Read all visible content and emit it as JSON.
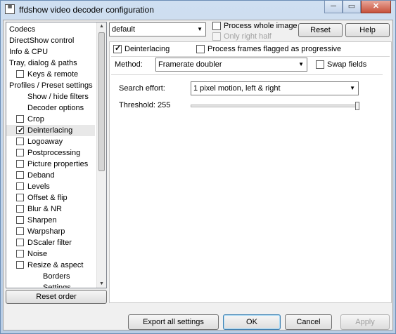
{
  "window": {
    "title": "ffdshow video decoder configuration",
    "minimize_glyph": "─",
    "maximize_glyph": "▭",
    "close_glyph": "✕"
  },
  "tree": {
    "items": [
      {
        "label": "Codecs",
        "checkbox": false,
        "checked": false,
        "indent": 0
      },
      {
        "label": "DirectShow control",
        "checkbox": false,
        "checked": false,
        "indent": 0
      },
      {
        "label": "Info & CPU",
        "checkbox": false,
        "checked": false,
        "indent": 0
      },
      {
        "label": "Tray, dialog & paths",
        "checkbox": false,
        "checked": false,
        "indent": 0
      },
      {
        "label": "Keys & remote",
        "checkbox": true,
        "checked": false,
        "indent": 1
      },
      {
        "label": "Profiles / Preset settings",
        "checkbox": false,
        "checked": false,
        "indent": 0
      },
      {
        "label": "Show / hide filters",
        "checkbox": false,
        "checked": false,
        "indent": 1
      },
      {
        "label": "Decoder options",
        "checkbox": false,
        "checked": false,
        "indent": 1
      },
      {
        "label": "Crop",
        "checkbox": true,
        "checked": false,
        "indent": 1
      },
      {
        "label": "Deinterlacing",
        "checkbox": true,
        "checked": true,
        "indent": 1,
        "selected": true
      },
      {
        "label": "Logoaway",
        "checkbox": true,
        "checked": false,
        "indent": 1
      },
      {
        "label": "Postprocessing",
        "checkbox": true,
        "checked": false,
        "indent": 1
      },
      {
        "label": "Picture properties",
        "checkbox": true,
        "checked": false,
        "indent": 1
      },
      {
        "label": "Deband",
        "checkbox": true,
        "checked": false,
        "indent": 1
      },
      {
        "label": "Levels",
        "checkbox": true,
        "checked": false,
        "indent": 1
      },
      {
        "label": "Offset & flip",
        "checkbox": true,
        "checked": false,
        "indent": 1
      },
      {
        "label": "Blur & NR",
        "checkbox": true,
        "checked": false,
        "indent": 1
      },
      {
        "label": "Sharpen",
        "checkbox": true,
        "checked": false,
        "indent": 1
      },
      {
        "label": "Warpsharp",
        "checkbox": true,
        "checked": false,
        "indent": 1
      },
      {
        "label": "DScaler filter",
        "checkbox": true,
        "checked": false,
        "indent": 1
      },
      {
        "label": "Noise",
        "checkbox": true,
        "checked": false,
        "indent": 1
      },
      {
        "label": "Resize & aspect",
        "checkbox": true,
        "checked": false,
        "indent": 1
      },
      {
        "label": "Borders",
        "checkbox": false,
        "checked": false,
        "indent": 2
      },
      {
        "label": "Settings",
        "checkbox": false,
        "checked": false,
        "indent": 2
      }
    ],
    "scroll_up_glyph": "▲",
    "scroll_down_glyph": "▼"
  },
  "reset_order_label": "Reset order",
  "top": {
    "preset_value": "default",
    "process_whole_image_label": "Process whole image",
    "process_whole_image_checked": false,
    "only_right_half_label": "Only right half",
    "only_right_half_checked": false,
    "reset_label": "Reset",
    "help_label": "Help",
    "dropdown_glyph": "▼"
  },
  "panel": {
    "deinterlacing_label": "Deinterlacing",
    "deinterlacing_checked": true,
    "process_progressive_label": "Process frames flagged as progressive",
    "process_progressive_checked": false,
    "method_label": "Method:",
    "method_value": "Framerate doubler",
    "swap_fields_label": "Swap fields",
    "swap_fields_checked": false,
    "search_effort_label": "Search effort:",
    "search_effort_value": "1 pixel motion, left & right",
    "threshold_label": "Threshold: 255",
    "threshold_fraction": 1.0
  },
  "footer": {
    "export_label": "Export all settings",
    "ok_label": "OK",
    "cancel_label": "Cancel",
    "apply_label": "Apply"
  }
}
